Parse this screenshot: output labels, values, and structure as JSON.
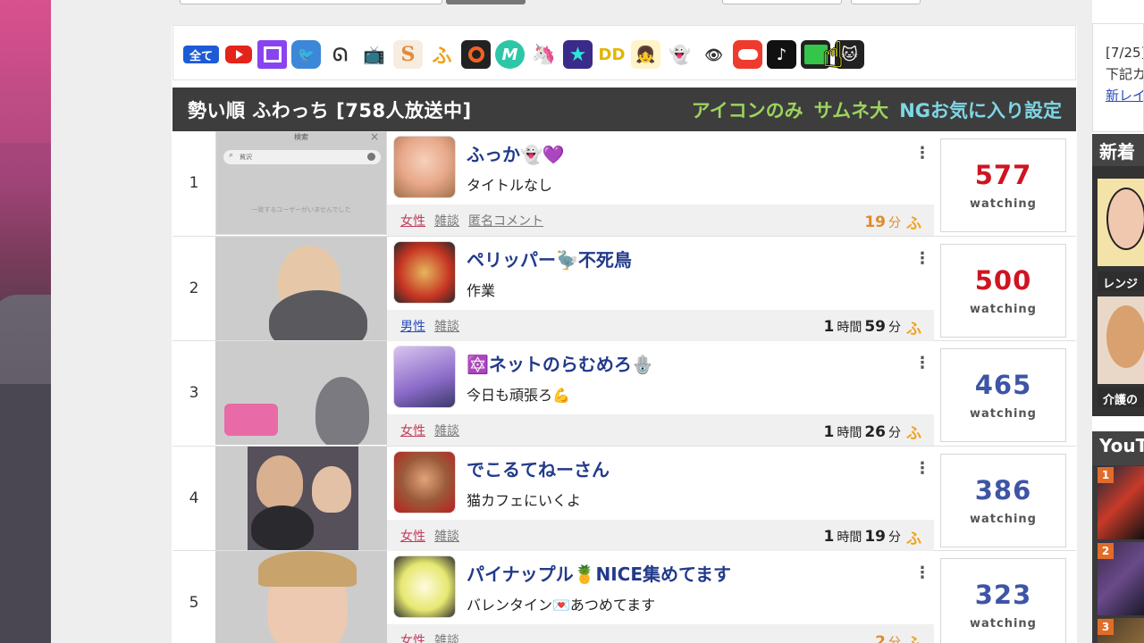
{
  "icon_bar": {
    "all_label": "全て",
    "icons": [
      "youtube-icon",
      "twitch-icon",
      "bird-icon",
      "cow-icon",
      "tv-icon",
      "s-icon",
      "fuwacchi-icon",
      "ring-icon",
      "m-icon",
      "unicorn-icon",
      "star-icon",
      "dd-icon",
      "girl-icon",
      "ghost-icon",
      "eye-icon",
      "red-pill-icon",
      "tiktok-icon",
      "fuwacchi-green-icon",
      "cat-icon"
    ]
  },
  "section": {
    "title": "勢い順 ふわっち [758人放送中]",
    "opt_icon_only": "アイコンのみ",
    "opt_thumb_large": "サムネ大",
    "opt_ng": "NGお気に入り設定"
  },
  "thumb1": {
    "header": "検索",
    "search_value": "貧沢",
    "no_results": "一致するユーザーがいませんでした"
  },
  "watching_label": "watching",
  "fu_mark": "ふ",
  "streams": [
    {
      "rank": "1",
      "name": "ふっか👻💜",
      "title": "タイトルなし",
      "tags": [
        "女性",
        "雑談",
        "匿名コメント"
      ],
      "dur_num1": "",
      "dur_unit1": "",
      "dur_num2": "19",
      "dur_unit2": "分",
      "viewers": "577",
      "color": "#cf1422"
    },
    {
      "rank": "2",
      "name": "ペリッパー🦤不死鳥",
      "title": "作業",
      "tags": [
        "男性",
        "雑談"
      ],
      "dur_num1": "1",
      "dur_unit1": "時間",
      "dur_num2": "59",
      "dur_unit2": "分",
      "viewers": "500",
      "color": "#cf1422"
    },
    {
      "rank": "3",
      "name": "🔯ネットのらむめろ🪬",
      "title": "今日も頑張ろ💪",
      "tags": [
        "女性",
        "雑談"
      ],
      "dur_num1": "1",
      "dur_unit1": "時間",
      "dur_num2": "26",
      "dur_unit2": "分",
      "viewers": "465",
      "color": "#3e55a6"
    },
    {
      "rank": "4",
      "name": "でこるてねーさん",
      "title": "猫カフェにいくよ",
      "tags": [
        "女性",
        "雑談"
      ],
      "dur_num1": "1",
      "dur_unit1": "時間",
      "dur_num2": "19",
      "dur_unit2": "分",
      "viewers": "386",
      "color": "#3e55a6"
    },
    {
      "rank": "5",
      "name": "パイナップル🍍NICE集めてます",
      "title": "バレンタイン💌あつめてます",
      "tags": [
        "女性",
        "雑談"
      ],
      "dur_num1": "",
      "dur_unit1": "",
      "dur_num2": "2",
      "dur_unit2": "分",
      "viewers": "323",
      "color": "#3e55a6"
    }
  ],
  "sidebar": {
    "notice_line1": "[7/25]",
    "notice_line2": "下記カ",
    "notice_link": "新レイ",
    "new_header": "新着",
    "card1_caption": "レンジ",
    "card2_caption": "介護の",
    "youtube_header": "YouT",
    "ranks": [
      "1",
      "2",
      "3"
    ]
  }
}
